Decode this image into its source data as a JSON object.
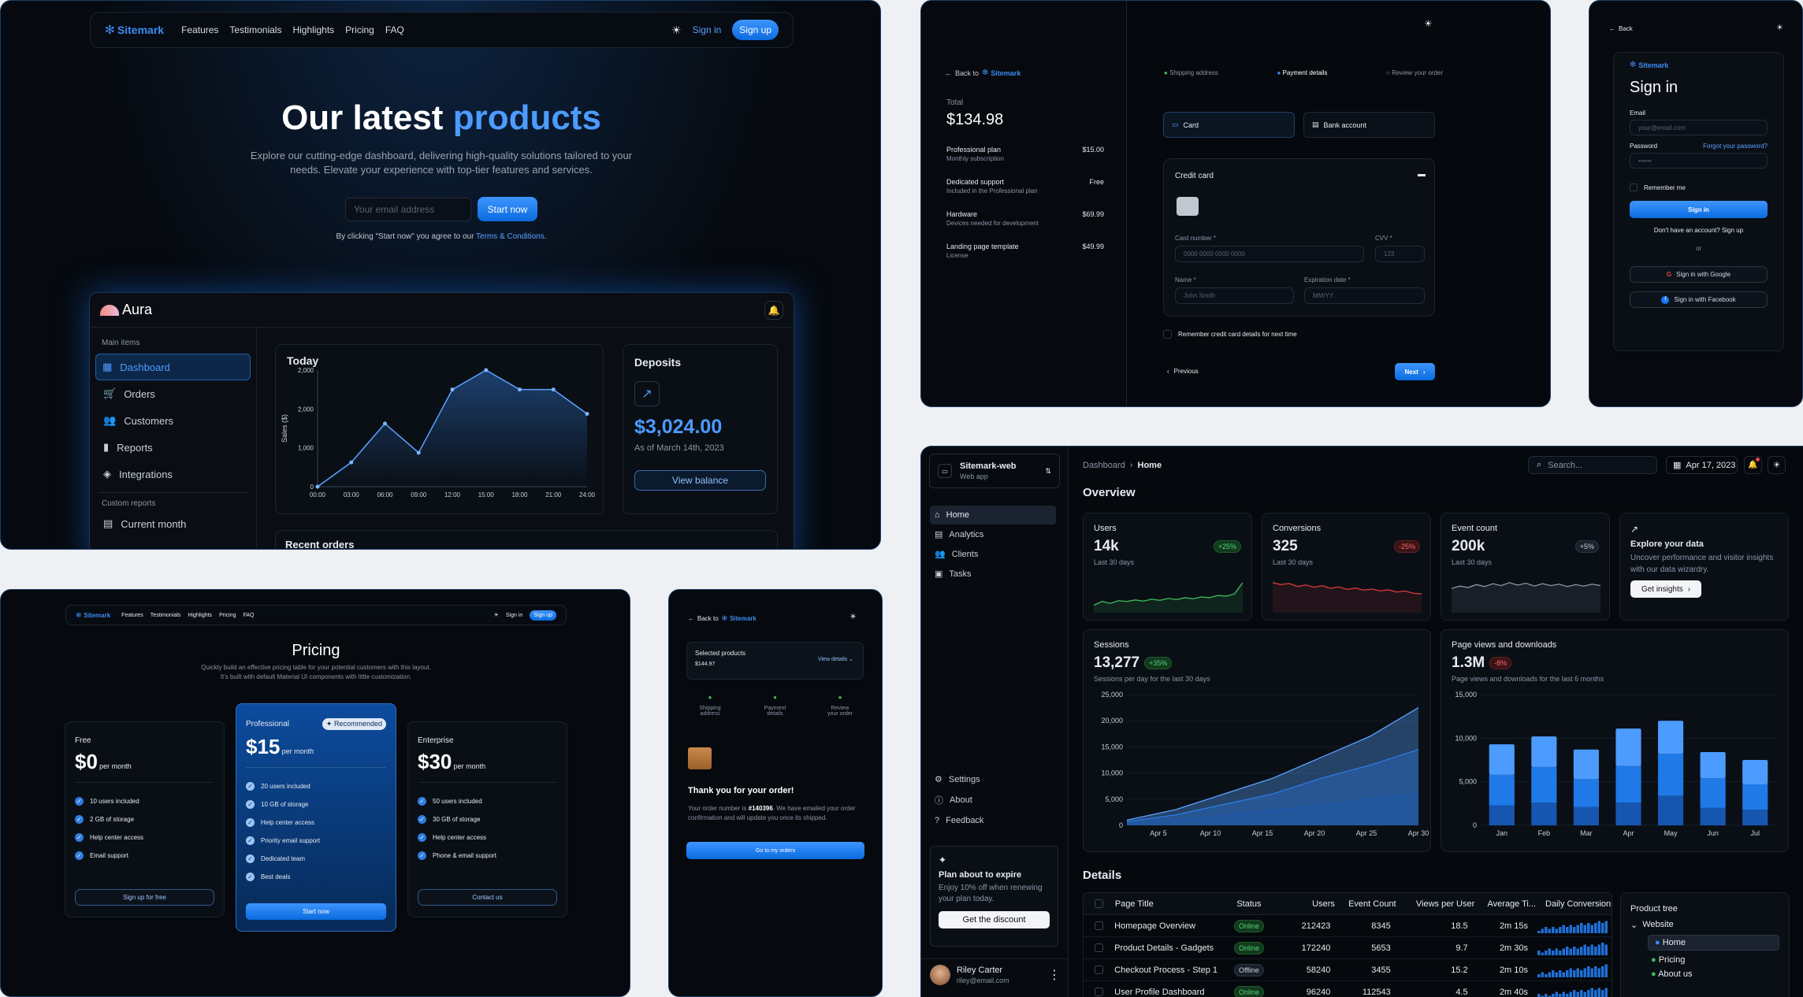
{
  "landing": {
    "logo": "Sitemark",
    "nav": [
      "Features",
      "Testimonials",
      "Highlights",
      "Pricing",
      "FAQ"
    ],
    "signin": "Sign in",
    "signup": "Sign up",
    "title_a": "Our latest ",
    "title_b": "products",
    "subtitle_1": "Explore our cutting-edge dashboard, delivering high-quality solutions tailored to your",
    "subtitle_2": "needs. Elevate your experience with top-tier features and services.",
    "email_placeholder": "Your email address",
    "start": "Start now",
    "terms_a": "By clicking \"Start now\" you agree to our ",
    "terms_b": "Terms & Conditions",
    "terms_c": "."
  },
  "aura": {
    "brand": "Aura",
    "main_items": "Main items",
    "items": [
      "Dashboard",
      "Orders",
      "Customers",
      "Reports",
      "Integrations"
    ],
    "custom_reports": "Custom reports",
    "current_month": "Current month",
    "today": "Today",
    "ylabel": "Sales ($)",
    "deposits": "Deposits",
    "amount": "$3,024.00",
    "as_of": "As of March 14th, 2023",
    "view_balance": "View balance",
    "recent_orders": "Recent orders"
  },
  "aura_chart": {
    "type": "line",
    "x": [
      "00:00",
      "03:00",
      "06:00",
      "09:00",
      "12:00",
      "15:00",
      "18:00",
      "21:00",
      "24:00"
    ],
    "values": [
      0,
      500,
      1300,
      700,
      2000,
      2400,
      2000,
      2000,
      1500
    ],
    "ylim": [
      0,
      2400
    ],
    "yticks": [
      "2,000",
      "2,000",
      "1,000",
      "0"
    ],
    "ylabel": "Sales ($)"
  },
  "checkout": {
    "back": "Back to",
    "logo": "Sitemark",
    "total_label": "Total",
    "total": "$134.98",
    "items": [
      {
        "name": "Professional plan",
        "sub": "Monthly subscription",
        "price": "$15.00"
      },
      {
        "name": "Dedicated support",
        "sub": "Included in the Professional plan",
        "price": "Free"
      },
      {
        "name": "Hardware",
        "sub": "Devices needed for development",
        "price": "$69.99"
      },
      {
        "name": "Landing page template",
        "sub": "License",
        "price": "$49.99"
      }
    ],
    "steps": [
      "Shipping address",
      "Payment details",
      "Review your order"
    ],
    "card": "Card",
    "bank": "Bank account",
    "credit_card": "Credit card",
    "card_number_label": "Card number *",
    "card_number_ph": "0000 0000 0000 0000",
    "cvv_label": "CVV *",
    "cvv_ph": "123",
    "name_label": "Name *",
    "name_ph": "John Smith",
    "exp_label": "Expiration date *",
    "exp_ph": "MM/YY",
    "remember": "Remember credit card details for next time",
    "previous": "Previous",
    "next": "Next"
  },
  "signin": {
    "back": "Back",
    "logo": "Sitemark",
    "title": "Sign in",
    "email_label": "Email",
    "email_ph": "your@email.com",
    "password_label": "Password",
    "forgot": "Forgot your password?",
    "password_ph": "••••••",
    "remember": "Remember me",
    "button": "Sign in",
    "no_account": "Don't have an account? Sign up",
    "or": "or",
    "google": "Sign in with Google",
    "facebook": "Sign in with Facebook"
  },
  "pricing": {
    "logo": "Sitemark",
    "nav": [
      "Features",
      "Testimonials",
      "Highlights",
      "Pricing",
      "FAQ"
    ],
    "signin": "Sign in",
    "signup": "Sign up",
    "title": "Pricing",
    "sub1": "Quickly build an effective pricing table for your potential customers with this layout.",
    "sub2": "It's built with default Material UI components with little customization.",
    "per": "per month",
    "plans": [
      {
        "name": "Free",
        "price": "$0",
        "features": [
          "10 users included",
          "2 GB of storage",
          "Help center access",
          "Email support"
        ],
        "cta": "Sign up for free"
      },
      {
        "name": "Professional",
        "badge": "Recommended",
        "price": "$15",
        "features": [
          "20 users included",
          "10 GB of storage",
          "Help center access",
          "Priority email support",
          "Dedicated team",
          "Best deals"
        ],
        "cta": "Start now"
      },
      {
        "name": "Enterprise",
        "price": "$30",
        "features": [
          "50 users included",
          "30 GB of storage",
          "Help center access",
          "Phone & email support"
        ],
        "cta": "Contact us"
      }
    ]
  },
  "order": {
    "back": "Back to",
    "logo": "Sitemark",
    "selected": "Selected products",
    "selected_price": "$144.97",
    "view_details": "View details",
    "steps": [
      "Shipping\naddress",
      "Payment\ndetails",
      "Review\nyour order"
    ],
    "thanks": "Thank you for your order!",
    "msg_a": "Your order number is ",
    "order_no": "#140396",
    "msg_b": ". We have emailed your order confirmation and will update you once its shipped.",
    "button": "Go to my orders"
  },
  "dash": {
    "app": "Sitemark-web",
    "app_sub": "Web app",
    "menu": [
      "Home",
      "Analytics",
      "Clients",
      "Tasks"
    ],
    "bottom_menu": [
      "Settings",
      "About",
      "Feedback"
    ],
    "promo_title": "Plan about to expire",
    "promo_text": "Enjoy 10% off when renewing your plan today.",
    "promo_btn": "Get the discount",
    "user": "Riley Carter",
    "email": "riley@email.com",
    "crumb": "Dashboard",
    "crumb_cur": "Home",
    "search_ph": "Search...",
    "date": "Apr 17, 2023",
    "overview": "Overview",
    "stats": [
      {
        "title": "Users",
        "value": "14k",
        "trend": "+25%",
        "sub": "Last 30 days"
      },
      {
        "title": "Conversions",
        "value": "325",
        "trend": "-25%",
        "sub": "Last 30 days"
      },
      {
        "title": "Event count",
        "value": "200k",
        "trend": "+5%",
        "sub": "Last 30 days"
      }
    ],
    "explore_title": "Explore your data",
    "explore_text": "Uncover performance and visitor insights with our data wizardry.",
    "explore_btn": "Get insights",
    "sessions_title": "Sessions",
    "sessions_value": "13,277",
    "sessions_trend": "+35%",
    "sessions_sub": "Sessions per day for the last 30 days",
    "pv_title": "Page views and downloads",
    "pv_value": "1.3M",
    "pv_trend": "-8%",
    "pv_sub": "Page views and downloads for the last 6 months",
    "details": "Details",
    "columns": [
      "Page Title",
      "Status",
      "Users",
      "Event Count",
      "Views per User",
      "Average Ti...",
      "Daily Conversions"
    ],
    "rows": [
      [
        "Homepage Overview",
        "Online",
        "212423",
        "8345",
        "18.5",
        "2m 15s"
      ],
      [
        "Product Details - Gadgets",
        "Online",
        "172240",
        "5653",
        "9.7",
        "2m 30s"
      ],
      [
        "Checkout Process - Step 1",
        "Offline",
        "58240",
        "3455",
        "15.2",
        "2m 10s"
      ],
      [
        "User Profile Dashboard",
        "Online",
        "96240",
        "112543",
        "4.5",
        "2m 40s"
      ]
    ],
    "tree_title": "Product tree",
    "tree": [
      "Website",
      "Home",
      "Pricing",
      "About us"
    ]
  },
  "chart_data": [
    {
      "type": "area",
      "title": "Sessions",
      "x": [
        "Apr 5",
        "Apr 10",
        "Apr 15",
        "Apr 20",
        "Apr 25",
        "Apr 30"
      ],
      "ylim": [
        0,
        25000
      ],
      "yticks": [
        "25,000",
        "20,000",
        "15,000",
        "10,000",
        "5,000",
        "0"
      ],
      "series": [
        {
          "values": [
            1000,
            3000,
            6000,
            9000,
            13000,
            17000,
            22500
          ]
        },
        {
          "values": [
            700,
            2000,
            4000,
            6000,
            9000,
            11500,
            14500
          ]
        },
        {
          "values": [
            300,
            900,
            1800,
            2800,
            3800,
            5000,
            6200
          ]
        }
      ]
    },
    {
      "type": "bar",
      "title": "Page views and downloads",
      "categories": [
        "Jan",
        "Feb",
        "Mar",
        "Apr",
        "May",
        "Jun",
        "Jul"
      ],
      "ylim": [
        0,
        15000
      ],
      "yticks": [
        "15,000",
        "10,000",
        "5,000",
        "0"
      ],
      "series": [
        {
          "values": [
            2300,
            2600,
            2100,
            2600,
            3400,
            2000,
            1800
          ]
        },
        {
          "values": [
            3500,
            4100,
            3200,
            4200,
            4800,
            3400,
            2900
          ]
        },
        {
          "values": [
            3500,
            3500,
            3400,
            4300,
            3800,
            3000,
            2800
          ]
        }
      ]
    },
    {
      "type": "line",
      "title": "Users",
      "values": [
        2,
        3,
        2.5,
        3.2,
        3,
        3.4,
        3.1,
        3.6,
        3.3,
        3.8,
        3.5,
        4,
        3.7,
        4.2,
        4,
        4.6,
        4.4,
        5,
        8
      ]
    },
    {
      "type": "line",
      "title": "Conversions",
      "values": [
        8,
        7.5,
        7.8,
        7,
        7.4,
        6.8,
        7.2,
        6.5,
        6.9,
        6.2,
        6.6,
        6,
        6.3,
        5.8,
        6.1,
        5.5,
        5.8,
        5.2,
        5
      ]
    },
    {
      "type": "line",
      "title": "Event count",
      "values": [
        5,
        5.5,
        5.2,
        5.8,
        5.4,
        6,
        5.6,
        6.2,
        5.7,
        6.1,
        5.5,
        6,
        5.6,
        5.9,
        5.4,
        5.8,
        5.5,
        5.9,
        5.6
      ]
    }
  ]
}
